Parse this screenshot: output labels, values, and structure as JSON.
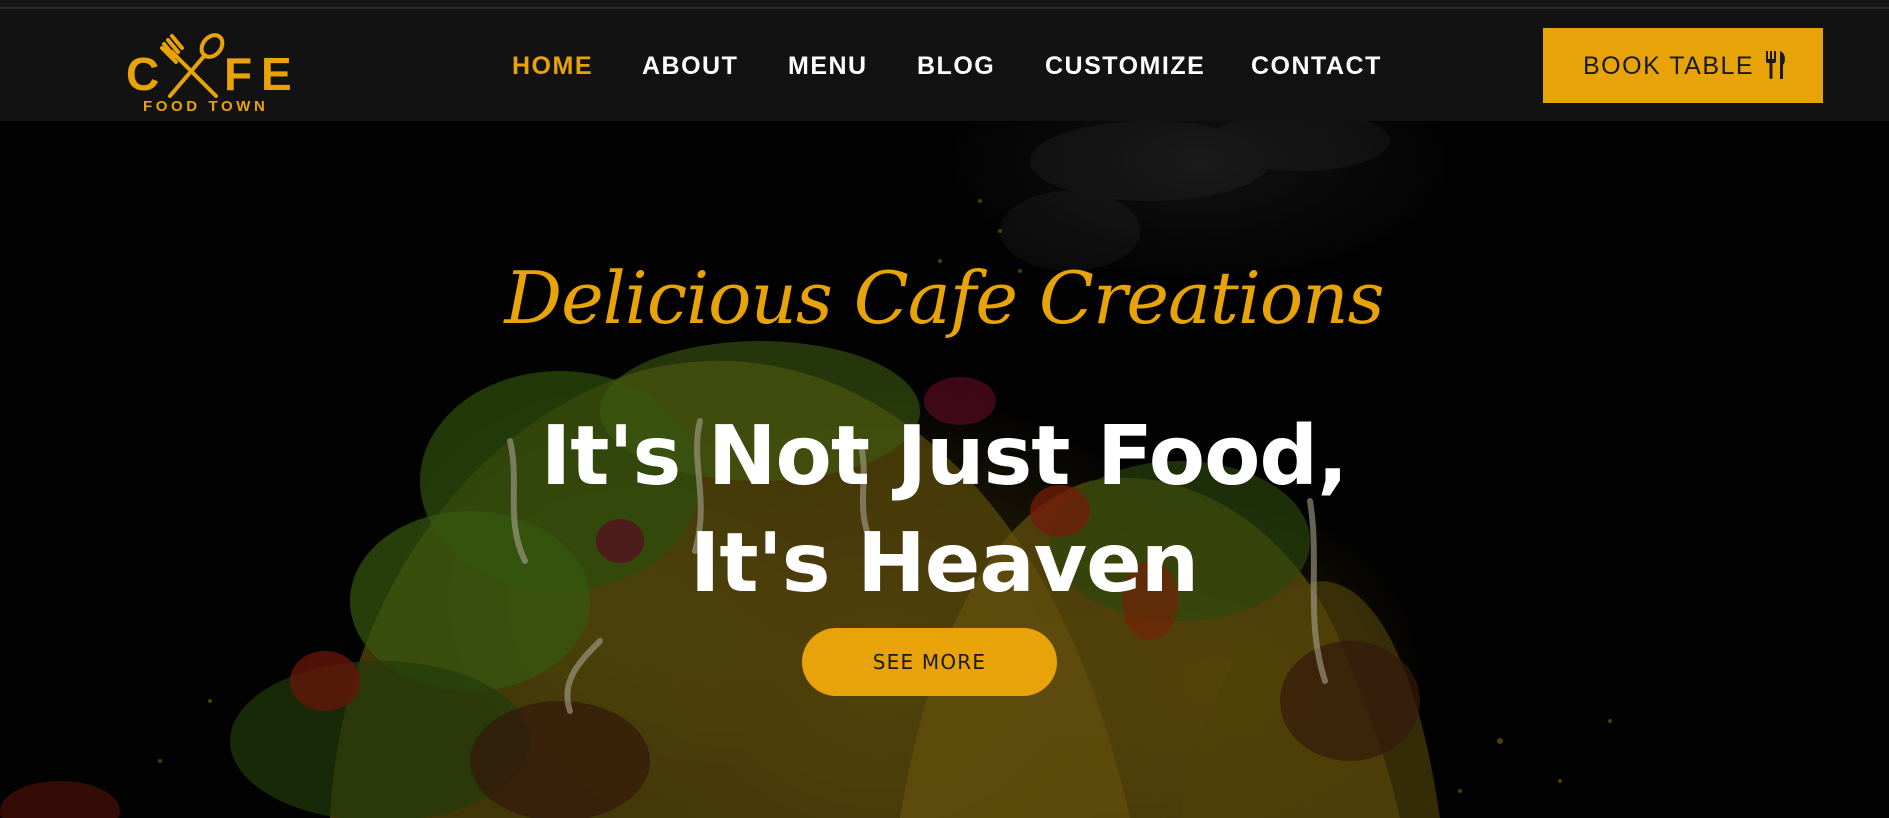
{
  "brand": {
    "logo_letters": [
      "C",
      "F",
      "E"
    ],
    "logo_subtitle": "FOOD TOWN",
    "logo_icon": "fork-spoon-cross-icon",
    "color": "#e8a308"
  },
  "nav": {
    "items": [
      {
        "label": "HOME",
        "active": true
      },
      {
        "label": "ABOUT",
        "active": false
      },
      {
        "label": "MENU",
        "active": false
      },
      {
        "label": "BLOG",
        "active": false
      },
      {
        "label": "CUSTOMIZE",
        "active": false
      },
      {
        "label": "CONTACT",
        "active": false
      }
    ],
    "book_label": "BOOK TABLE",
    "book_icon": "utensils-icon"
  },
  "hero": {
    "script_title": "Delicious Cafe Creations",
    "headline_line1": "It's Not Just Food,",
    "headline_line2": "It's Heaven",
    "cta_label": "SEE MORE"
  },
  "colors": {
    "accent": "#e8a308",
    "nav_bg": "#121212",
    "text_light": "#ffffff",
    "text_dark": "#1a1a1a"
  }
}
